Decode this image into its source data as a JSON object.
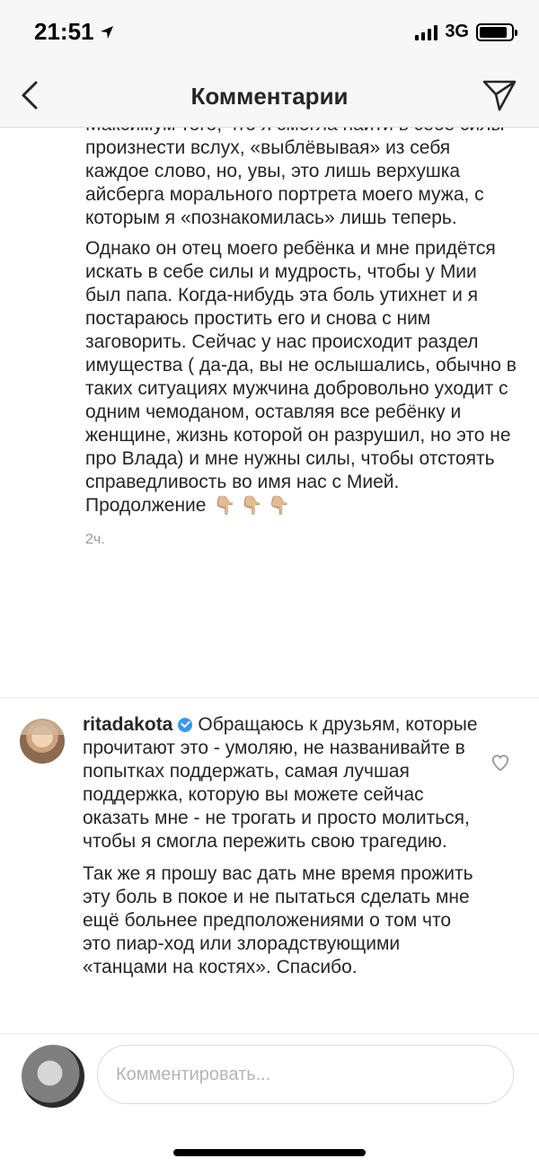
{
  "status": {
    "time": "21:51",
    "network": "3G"
  },
  "header": {
    "title": "Комментарии"
  },
  "comment1": {
    "paragraphs": [
      "Максимум того, что я смогла найти в себе силы произнести вслух, «выблёвывая» из себя каждое слово, но, увы, это лишь верхушка айсберга морального портрета моего мужа, с которым я «познакомилась» лишь теперь.",
      "Однако он отец моего ребёнка и мне придётся искать в себе силы и мудрость, чтобы у Мии был папа. Когда-нибудь эта боль утихнет и я постараюсь простить его и снова с ним заговорить. Сейчас у нас происходит раздел имущества ( да-да, вы не ослышались, обычно в таких ситуациях мужчина добровольно уходит с одним чемоданом, оставляя все ребёнку и женщине, жизнь которой он разрушил, но это не про Влада) и мне нужны силы, чтобы отстоять справедливость во имя нас с Мией. Продолжение"
    ],
    "emoji": "👇🏼 👇🏼 👇🏼",
    "time": "2ч."
  },
  "comment2": {
    "username": "ritadakota",
    "paragraphs": [
      "Обращаюсь к друзьям, которые прочитают это - умоляю, не названивайте в попытках поддержать, самая лучшая поддержка, которую вы можете сейчас оказать мне - не трогать  и просто молиться, чтобы я смогла пережить свою трагедию.",
      "Так же я прошу вас дать мне время прожить эту боль в покое и не пытаться сделать мне ещё больнее предположениями о том что это пиар-ход или злорадствующими «танцами на костях». Спасибо."
    ]
  },
  "footer": {
    "input_placeholder": "Комментировать..."
  },
  "icons": {
    "back": "chevron-left-icon",
    "send": "paper-plane-icon",
    "like": "heart-icon",
    "verified": "verified-badge-icon"
  },
  "colors": {
    "accent": "#3897f0",
    "text": "#262626",
    "muted": "#999999"
  }
}
